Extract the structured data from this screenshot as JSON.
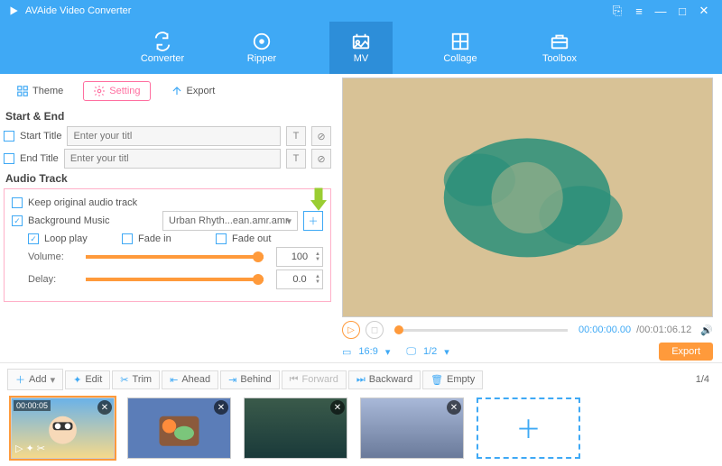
{
  "app": {
    "title": "AVAide Video Converter"
  },
  "windowControls": {
    "convert": "⎘",
    "menu": "≡",
    "min": "—",
    "max": "□",
    "close": "✕"
  },
  "nav": {
    "converter": "Converter",
    "ripper": "Ripper",
    "mv": "MV",
    "collage": "Collage",
    "toolbox": "Toolbox"
  },
  "tabs": {
    "theme": "Theme",
    "setting": "Setting",
    "export": "Export"
  },
  "sections": {
    "startend": "Start & End",
    "start_title_label": "Start Title",
    "end_title_label": "End Title",
    "title_placeholder": "Enter your titl",
    "audio_track": "Audio Track",
    "keep_original": "Keep original audio track",
    "bgm_label": "Background Music",
    "bgm_file": "Urban Rhyth...ean.amr.amr",
    "loop": "Loop play",
    "fadein": "Fade in",
    "fadeout": "Fade out",
    "volume_label": "Volume:",
    "volume_val": "100",
    "delay_label": "Delay:",
    "delay_val": "0.0"
  },
  "player": {
    "t_cur": "00:00:00.00",
    "t_total": "/00:01:06.12",
    "aspect": "16:9",
    "page": "1/2",
    "export": "Export"
  },
  "actions": {
    "add": "Add",
    "edit": "Edit",
    "trim": "Trim",
    "ahead": "Ahead",
    "behind": "Behind",
    "forward": "Forward",
    "backward": "Backward",
    "empty": "Empty",
    "pagecount": "1/4"
  },
  "thumbs": {
    "t1_time": "00:00:05"
  }
}
